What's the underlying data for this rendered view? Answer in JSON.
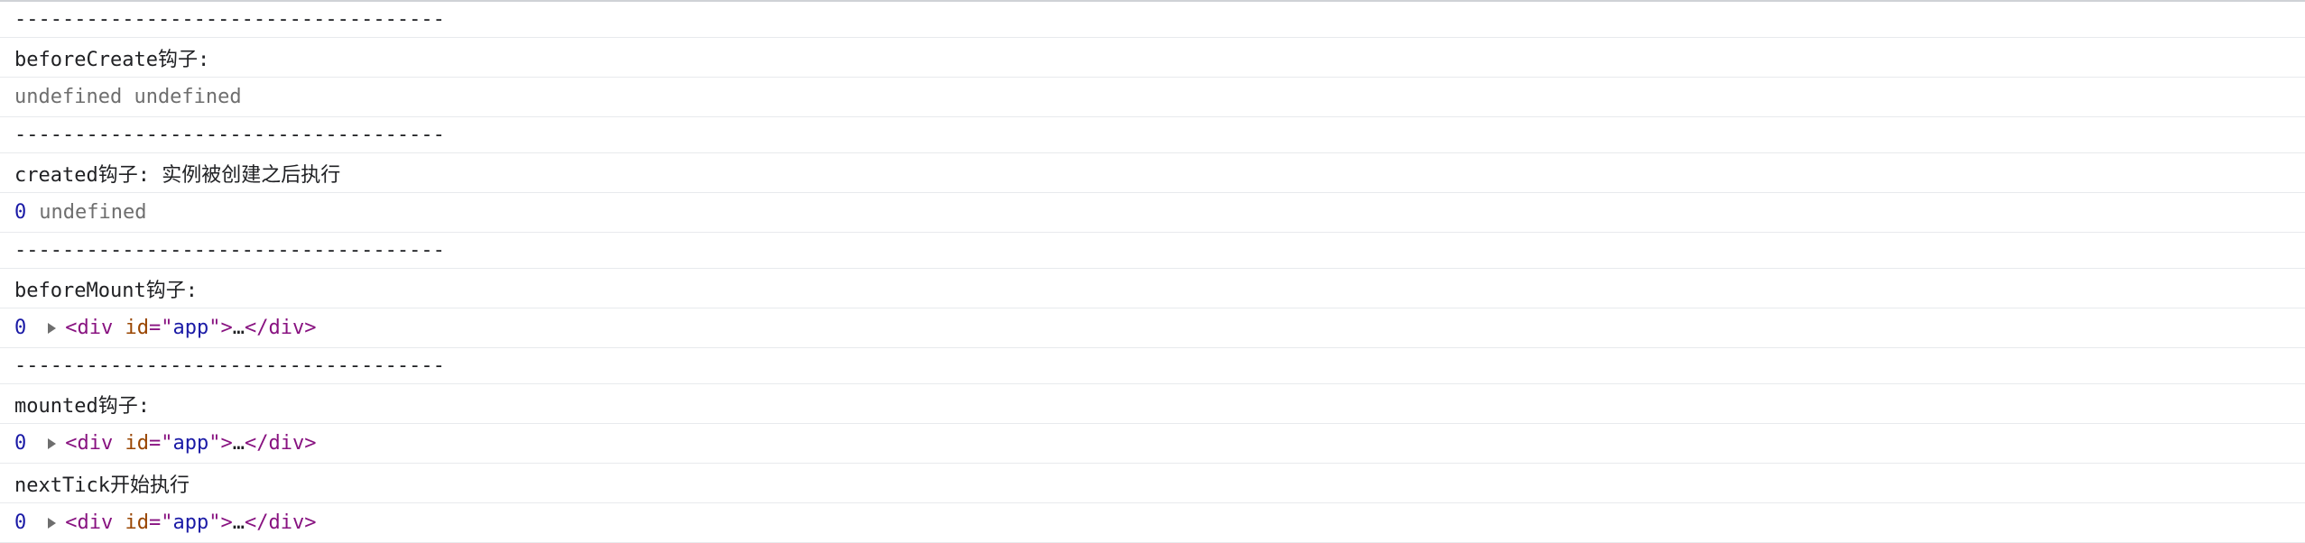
{
  "console": {
    "rows": [
      {
        "type": "sep",
        "text": "------------------------------------"
      },
      {
        "type": "log",
        "text": "beforeCreate钩子:"
      },
      {
        "type": "values",
        "text": "undefined undefined"
      },
      {
        "type": "sep",
        "text": "------------------------------------"
      },
      {
        "type": "log",
        "text": "created钩子: 实例被创建之后执行"
      },
      {
        "type": "num_undef",
        "num": "0",
        "rest": "undefined"
      },
      {
        "type": "sep",
        "text": "------------------------------------"
      },
      {
        "type": "log",
        "text": "beforeMount钩子:"
      },
      {
        "type": "element",
        "num": "0"
      },
      {
        "type": "sep",
        "text": "------------------------------------"
      },
      {
        "type": "log",
        "text": "mounted钩子:"
      },
      {
        "type": "element",
        "num": "0"
      },
      {
        "type": "log",
        "text": "nextTick开始执行"
      },
      {
        "type": "element",
        "num": "0"
      }
    ],
    "element": {
      "open_lt": "<",
      "tag": "div",
      "attr": "id",
      "eq": "=",
      "quote_open": "\"",
      "value": "app",
      "quote_close": "\"",
      "gt": ">",
      "ellipsis": "…",
      "close": "</div>"
    },
    "colors": {
      "number": "#1a1aa6",
      "tag": "#881280",
      "attribute": "#994500",
      "muted": "#6e6e6e"
    }
  }
}
